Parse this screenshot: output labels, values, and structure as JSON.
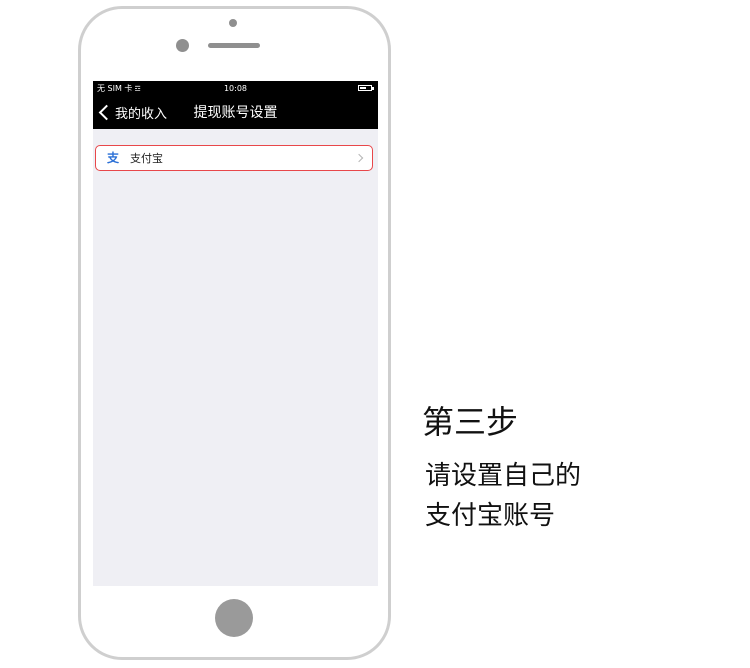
{
  "status_bar": {
    "carrier": "无 SIM 卡",
    "wifi_icon": "wifi-icon",
    "time": "10:08",
    "battery_icon": "battery-icon"
  },
  "nav": {
    "back_label": "我的收入",
    "title": "提现账号设置"
  },
  "list": {
    "items": [
      {
        "label": "支付宝",
        "icon": "alipay-icon"
      }
    ]
  },
  "caption": {
    "title": "第三步",
    "line1": "请设置自己的",
    "line2": "支付宝账号"
  },
  "colors": {
    "highlight_border": "#e8474a",
    "nav_background": "#000000",
    "screen_background": "#efeff4"
  }
}
